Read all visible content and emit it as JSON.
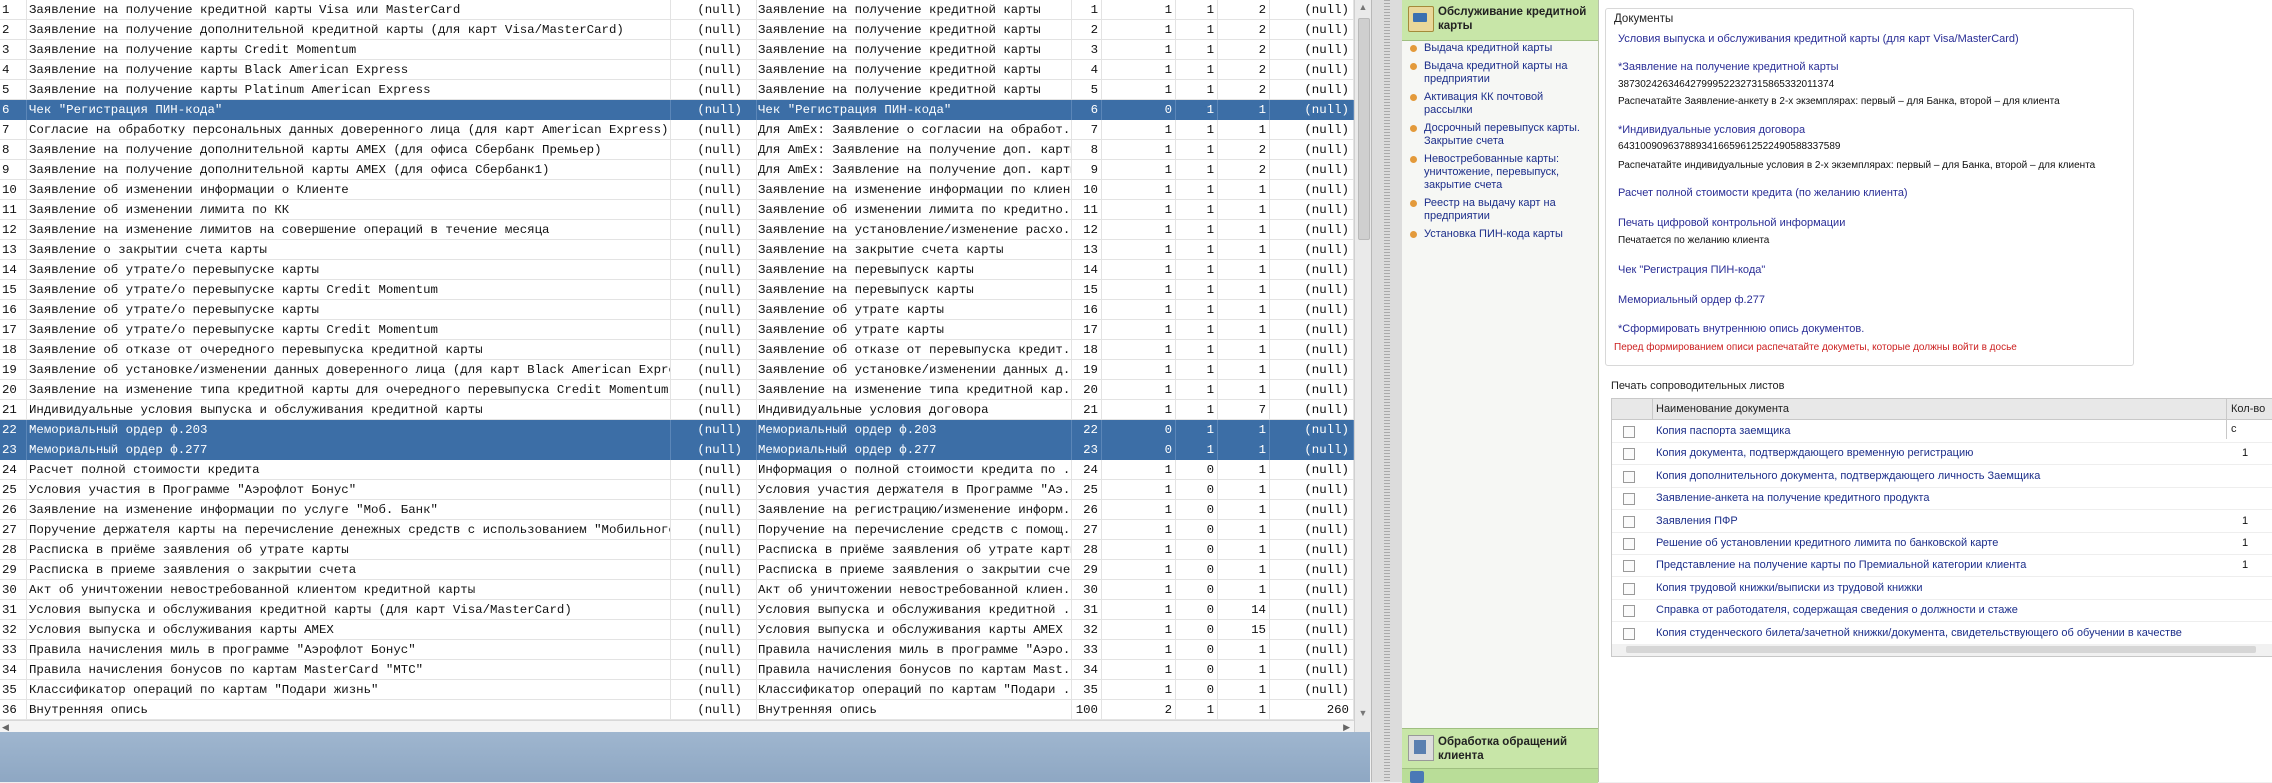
{
  "grid": {
    "rows": [
      {
        "num": "1",
        "name": "Заявление на получение кредитной карты Visa или MasterCard",
        "n1": "(null)",
        "desc": "Заявление на получение кредитной карты",
        "a": "1",
        "b": "1",
        "c": "1",
        "d": "2",
        "n2": "(null)",
        "selected": false
      },
      {
        "num": "2",
        "name": "Заявление на получение дополнительной кредитной карты (для карт Visa/MasterCard)",
        "n1": "(null)",
        "desc": "Заявление на получение кредитной карты",
        "a": "2",
        "b": "1",
        "c": "1",
        "d": "2",
        "n2": "(null)",
        "selected": false
      },
      {
        "num": "3",
        "name": "Заявление на получение карты Credit Momentum",
        "n1": "(null)",
        "desc": "Заявление на получение кредитной карты",
        "a": "3",
        "b": "1",
        "c": "1",
        "d": "2",
        "n2": "(null)",
        "selected": false
      },
      {
        "num": "4",
        "name": "Заявление на получение карты Black American Express",
        "n1": "(null)",
        "desc": "Заявление на получение кредитной карты",
        "a": "4",
        "b": "1",
        "c": "1",
        "d": "2",
        "n2": "(null)",
        "selected": false
      },
      {
        "num": "5",
        "name": "Заявление на получение карты Platinum American Express",
        "n1": "(null)",
        "desc": "Заявление на получение кредитной карты",
        "a": "5",
        "b": "1",
        "c": "1",
        "d": "2",
        "n2": "(null)",
        "selected": false
      },
      {
        "num": "6",
        "name": "Чек \"Регистрация ПИН-кода\"",
        "n1": "(null)",
        "desc": "Чек \"Регистрация ПИН-кода\"",
        "a": "6",
        "b": "0",
        "c": "1",
        "d": "1",
        "n2": "(null)",
        "selected": true
      },
      {
        "num": "7",
        "name": "Согласие на обработку персональных данных доверенного лица (для карт American Express)",
        "n1": "(null)",
        "desc": "Для AmEx: Заявление о согласии на обработ...",
        "a": "7",
        "b": "1",
        "c": "1",
        "d": "1",
        "n2": "(null)",
        "selected": false
      },
      {
        "num": "8",
        "name": "Заявление на получение дополнительной карты АМЕХ (для офиса Сбербанк Премьер)",
        "n1": "(null)",
        "desc": "Для AmEx: Заявление на получение доп. карты",
        "a": "8",
        "b": "1",
        "c": "1",
        "d": "2",
        "n2": "(null)",
        "selected": false
      },
      {
        "num": "9",
        "name": "Заявление на получение дополнительной карты АМЕХ (для офиса Сбербанк1)",
        "n1": "(null)",
        "desc": "Для AmEx: Заявление на получение доп. карты",
        "a": "9",
        "b": "1",
        "c": "1",
        "d": "2",
        "n2": "(null)",
        "selected": false
      },
      {
        "num": "10",
        "name": "Заявление об изменении информации о Клиенте",
        "n1": "(null)",
        "desc": "Заявление на изменение информации по клиенту",
        "a": "10",
        "b": "1",
        "c": "1",
        "d": "1",
        "n2": "(null)",
        "selected": false
      },
      {
        "num": "11",
        "name": "Заявление об изменении лимита по КК",
        "n1": "(null)",
        "desc": "Заявление об изменении лимита по кредитно...",
        "a": "11",
        "b": "1",
        "c": "1",
        "d": "1",
        "n2": "(null)",
        "selected": false
      },
      {
        "num": "12",
        "name": "Заявление на изменение лимитов на совершение операций в течение месяца",
        "n1": "(null)",
        "desc": "Заявление на установление/изменение расхо...",
        "a": "12",
        "b": "1",
        "c": "1",
        "d": "1",
        "n2": "(null)",
        "selected": false
      },
      {
        "num": "13",
        "name": "Заявление о закрытии счета карты",
        "n1": "(null)",
        "desc": "Заявление на закрытие счета карты",
        "a": "13",
        "b": "1",
        "c": "1",
        "d": "1",
        "n2": "(null)",
        "selected": false
      },
      {
        "num": "14",
        "name": "Заявление об утрате/о перевыпуске карты",
        "n1": "(null)",
        "desc": "Заявление на перевыпуск карты",
        "a": "14",
        "b": "1",
        "c": "1",
        "d": "1",
        "n2": "(null)",
        "selected": false
      },
      {
        "num": "15",
        "name": "Заявление об утрате/о перевыпуске карты Credit Momentum",
        "n1": "(null)",
        "desc": "Заявление на перевыпуск карты",
        "a": "15",
        "b": "1",
        "c": "1",
        "d": "1",
        "n2": "(null)",
        "selected": false
      },
      {
        "num": "16",
        "name": "Заявление об утрате/о перевыпуске карты",
        "n1": "(null)",
        "desc": "Заявление об утрате карты",
        "a": "16",
        "b": "1",
        "c": "1",
        "d": "1",
        "n2": "(null)",
        "selected": false
      },
      {
        "num": "17",
        "name": "Заявление об утрате/о перевыпуске карты Credit Momentum",
        "n1": "(null)",
        "desc": "Заявление об утрате карты",
        "a": "17",
        "b": "1",
        "c": "1",
        "d": "1",
        "n2": "(null)",
        "selected": false
      },
      {
        "num": "18",
        "name": "Заявление об отказе от очередного перевыпуска кредитной карты",
        "n1": "(null)",
        "desc": "Заявление об отказе от перевыпуска кредит...",
        "a": "18",
        "b": "1",
        "c": "1",
        "d": "1",
        "n2": "(null)",
        "selected": false
      },
      {
        "num": "19",
        "name": "Заявление об установке/изменении данных доверенного лица (для карт Black American Express)",
        "n1": "(null)",
        "desc": "Заявление об установке/изменении данных д...",
        "a": "19",
        "b": "1",
        "c": "1",
        "d": "1",
        "n2": "(null)",
        "selected": false
      },
      {
        "num": "20",
        "name": "Заявление на изменение типа кредитной карты для очередного перевыпуска Credit Momentum",
        "n1": "(null)",
        "desc": "Заявление на изменение типа кредитной кар...",
        "a": "20",
        "b": "1",
        "c": "1",
        "d": "1",
        "n2": "(null)",
        "selected": false
      },
      {
        "num": "21",
        "name": "Индивидуальные условия выпуска и обслуживания кредитной карты",
        "n1": "(null)",
        "desc": "Индивидуальные условия договора",
        "a": "21",
        "b": "1",
        "c": "1",
        "d": "7",
        "n2": "(null)",
        "selected": false
      },
      {
        "num": "22",
        "name": "Мемориальный ордер ф.203",
        "n1": "(null)",
        "desc": "Мемориальный ордер ф.203",
        "a": "22",
        "b": "0",
        "c": "1",
        "d": "1",
        "n2": "(null)",
        "selected": true
      },
      {
        "num": "23",
        "name": "Мемориальный ордер ф.277",
        "n1": "(null)",
        "desc": "Мемориальный ордер ф.277",
        "a": "23",
        "b": "0",
        "c": "1",
        "d": "1",
        "n2": "(null)",
        "selected": true
      },
      {
        "num": "24",
        "name": "Расчет полной стоимости кредита",
        "n1": "(null)",
        "desc": "Информация о полной стоимости кредита по ...",
        "a": "24",
        "b": "1",
        "c": "0",
        "d": "1",
        "n2": "(null)",
        "selected": false
      },
      {
        "num": "25",
        "name": "Условия участия в Программе \"Аэрофлот Бонус\"",
        "n1": "(null)",
        "desc": "Условия участия держателя в Программе \"Аэ...",
        "a": "25",
        "b": "1",
        "c": "0",
        "d": "1",
        "n2": "(null)",
        "selected": false
      },
      {
        "num": "26",
        "name": "Заявление на изменение информации по услуге \"Моб. Банк\"",
        "n1": "(null)",
        "desc": "Заявление на регистрацию/изменение информ...",
        "a": "26",
        "b": "1",
        "c": "0",
        "d": "1",
        "n2": "(null)",
        "selected": false
      },
      {
        "num": "27",
        "name": "Поручение держателя карты на перечисление денежных средств с использованием \"Мобильного ...",
        "n1": "(null)",
        "desc": "Поручение на перечисление средств с помощ...",
        "a": "27",
        "b": "1",
        "c": "0",
        "d": "1",
        "n2": "(null)",
        "selected": false
      },
      {
        "num": "28",
        "name": "Расписка в приёме заявления об утрате карты",
        "n1": "(null)",
        "desc": "Расписка в приёме заявления об утрате карты",
        "a": "28",
        "b": "1",
        "c": "0",
        "d": "1",
        "n2": "(null)",
        "selected": false
      },
      {
        "num": "29",
        "name": "Расписка в приеме заявления о закрытии счета",
        "n1": "(null)",
        "desc": "Расписка в приеме заявления о закрытии счета",
        "a": "29",
        "b": "1",
        "c": "0",
        "d": "1",
        "n2": "(null)",
        "selected": false
      },
      {
        "num": "30",
        "name": "Акт об уничтожении невостребованной клиентом кредитной карты",
        "n1": "(null)",
        "desc": "Акт об уничтожении невостребованной клиен...",
        "a": "30",
        "b": "1",
        "c": "0",
        "d": "1",
        "n2": "(null)",
        "selected": false
      },
      {
        "num": "31",
        "name": "Условия выпуска и обслуживания кредитной карты (для карт Visa/MasterCard)",
        "n1": "(null)",
        "desc": "Условия выпуска и обслуживания кредитной ...",
        "a": "31",
        "b": "1",
        "c": "0",
        "d": "14",
        "n2": "(null)",
        "selected": false
      },
      {
        "num": "32",
        "name": "Условия выпуска и обслуживания карты АМЕХ",
        "n1": "(null)",
        "desc": "Условия выпуска и обслуживания карты АМЕХ",
        "a": "32",
        "b": "1",
        "c": "0",
        "d": "15",
        "n2": "(null)",
        "selected": false
      },
      {
        "num": "33",
        "name": "Правила начисления миль в программе \"Аэрофлот Бонус\"",
        "n1": "(null)",
        "desc": "Правила начисления миль в программе \"Аэро...",
        "a": "33",
        "b": "1",
        "c": "0",
        "d": "1",
        "n2": "(null)",
        "selected": false
      },
      {
        "num": "34",
        "name": "Правила начисления бонусов по картам MasterCard \"МТС\"",
        "n1": "(null)",
        "desc": "Правила начисления бонусов по картам Mast...",
        "a": "34",
        "b": "1",
        "c": "0",
        "d": "1",
        "n2": "(null)",
        "selected": false
      },
      {
        "num": "35",
        "name": "Классификатор операций по картам \"Подари жизнь\"",
        "n1": "(null)",
        "desc": "Классификатор операций по картам \"Подари ...",
        "a": "35",
        "b": "1",
        "c": "0",
        "d": "1",
        "n2": "(null)",
        "selected": false
      },
      {
        "num": "36",
        "name": "Внутренняя опись",
        "n1": "(null)",
        "desc": "Внутренняя опись",
        "a": "100",
        "b": "2",
        "c": "1",
        "d": "1",
        "n2": "260",
        "selected": false
      }
    ]
  },
  "nav": {
    "header_title": "Обслуживание кредитной карты",
    "links": [
      "Выдача кредитной карты",
      "Выдача кредитной карты на предприятии",
      "Активация КК почтовой рассылки",
      "Досрочный перевыпуск карты. Закрытие счета",
      "Невостребованные карты: уничтожение, перевыпуск, закрытие счета",
      "Реестр на выдачу карт на предприятии",
      "Установка ПИН-кода карты"
    ],
    "footer_title": "Обработка обращений клиента"
  },
  "documents": {
    "title": "Документы",
    "link_conditions": "Условия выпуска и обслуживания кредитной карты (для карт Visa/MasterCard)",
    "link_application": "*Заявление на получение кредитной карты",
    "application_number": "38730242634642799952232731586533​2011374",
    "application_note": "Распечатайте Заявление-анкету в 2-х экземплярах: первый – для Банка, второй – для клиента",
    "link_individual": "*Индивидуальные условия договора",
    "individual_number": "64310090963788934166596125224905883​37589",
    "individual_note": "Распечатайте индивидуальные условия в 2-х экземплярах: первый – для Банка, второй – для клиента",
    "link_cost": "Расчет полной стоимости кредита (по желанию клиента)",
    "link_digital": "Печать цифровой контрольной информации",
    "digital_note": "Печатается по желанию клиента",
    "link_pin": "Чек \"Регистрация ПИН-кода\"",
    "link_memo": "Мемориальный ордер ф.277",
    "link_inventory": "*Сформировать внутреннюю опись документов.",
    "inventory_warning": "Перед формированием описи распечатайте докуметы, которые должны войти в досье"
  },
  "print_sheets": {
    "title": "Печать сопроводительных листов",
    "col_name": "Наименование документа",
    "col_qty": "Кол-во с",
    "rows": [
      {
        "name": "Копия паспорта заемщика",
        "qty": ""
      },
      {
        "name": "Копия документа, подтверждающего временную регистрацию",
        "qty": "1"
      },
      {
        "name": "Копия дополнительного документа, подтверждающего личность Заемщика",
        "qty": ""
      },
      {
        "name": "Заявление-анкета на получение кредитного продукта",
        "qty": ""
      },
      {
        "name": "Заявления ПФР",
        "qty": "1"
      },
      {
        "name": "Решение об установлении кредитного лимита по банковской карте",
        "qty": "1"
      },
      {
        "name": "Представление на получение карты по Премиальной категории клиента",
        "qty": "1"
      },
      {
        "name": "Копия трудовой книжки/выписки из трудовой книжки",
        "qty": ""
      },
      {
        "name": "Справка от работодателя, содержащая сведения о должности и стаже",
        "qty": ""
      },
      {
        "name": "Копия студенческого билета/зачетной книжки/документа, свидетельствующего об обучении в качестве",
        "qty": ""
      }
    ]
  },
  "colors": {
    "selection": "#3c6ea6",
    "link": "#2a2e96",
    "nav_header": "#c8e6a8",
    "warning": "#cc1f1f"
  }
}
